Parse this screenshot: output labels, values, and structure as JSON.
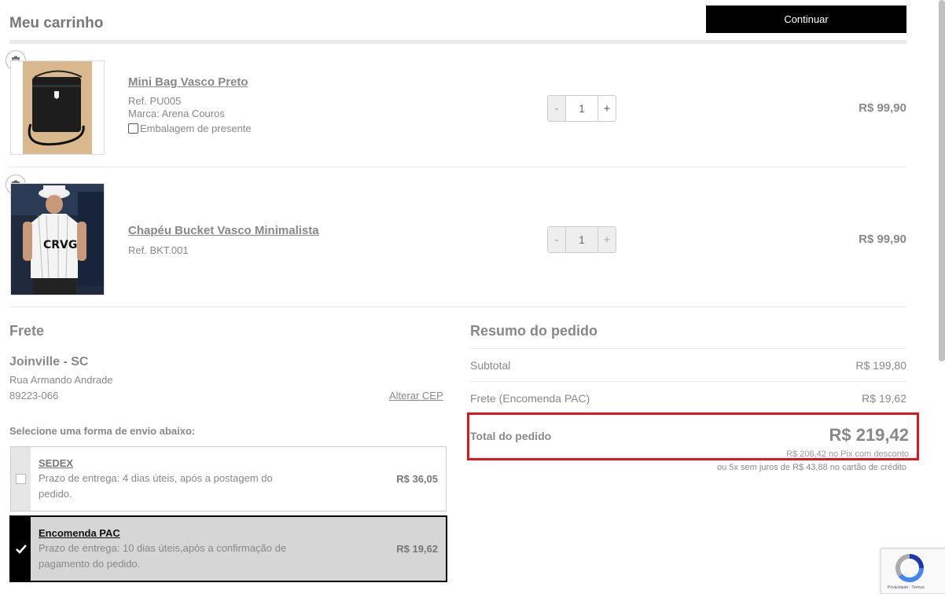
{
  "page": {
    "title": "Meu carrinho",
    "continue_label": "Continuar"
  },
  "cart": {
    "items": [
      {
        "name": "Mini Bag Vasco Preto",
        "ref": "Ref. PU005",
        "brand": "Marca: Arena Couros",
        "gift_label": "Embalagem de presente",
        "quantity": "1",
        "minus": "-",
        "plus": "+",
        "price": "R$ 99,90"
      },
      {
        "name": "Chapéu Bucket Vasco Minimalista",
        "ref": "Ref. BKT.001",
        "quantity": "1",
        "minus": "-",
        "plus": "+",
        "price": "R$ 99,90"
      }
    ]
  },
  "shipping": {
    "title": "Frete",
    "city": "Joinville - SC",
    "street": "Rua Armando Andrade",
    "cep": "89223-066",
    "change_cep": "Alterar CEP",
    "select_label": "Selecione uma forma de envio abaixo:",
    "options": [
      {
        "name": "SEDEX",
        "desc_line1": "Prazo de entrega: 4 dias úteis, após a postagem do",
        "desc_line2": "pedido.",
        "price": "R$ 36,05",
        "selected": false
      },
      {
        "name": "Encomenda PAC",
        "desc_line1": "Prazo de entrega: 10 dias úteis,após a confirmação de",
        "desc_line2": "pagamento do pedido.",
        "price": "R$ 19,62",
        "selected": true
      }
    ]
  },
  "summary": {
    "title": "Resumo do pedido",
    "subtotal_label": "Subtotal",
    "subtotal_value": "R$ 199,80",
    "shipping_label": "Frete (Encomenda PAC)",
    "shipping_value": "R$ 19,62",
    "total_label": "Total do pedido",
    "total_value": "R$ 219,42",
    "pix_note": "R$ 208,42 no Pix com desconto",
    "installments_note": "ou 5x sem juros de R$ 43,88 no cartão de crédito"
  },
  "recaptcha": {
    "footer": "Privacidade - Termos"
  },
  "colors": {
    "highlight": "#e0161e",
    "button": "#000000"
  },
  "icons": [
    "trash-icon",
    "checkmark-icon",
    "recaptcha-logo-icon"
  ]
}
